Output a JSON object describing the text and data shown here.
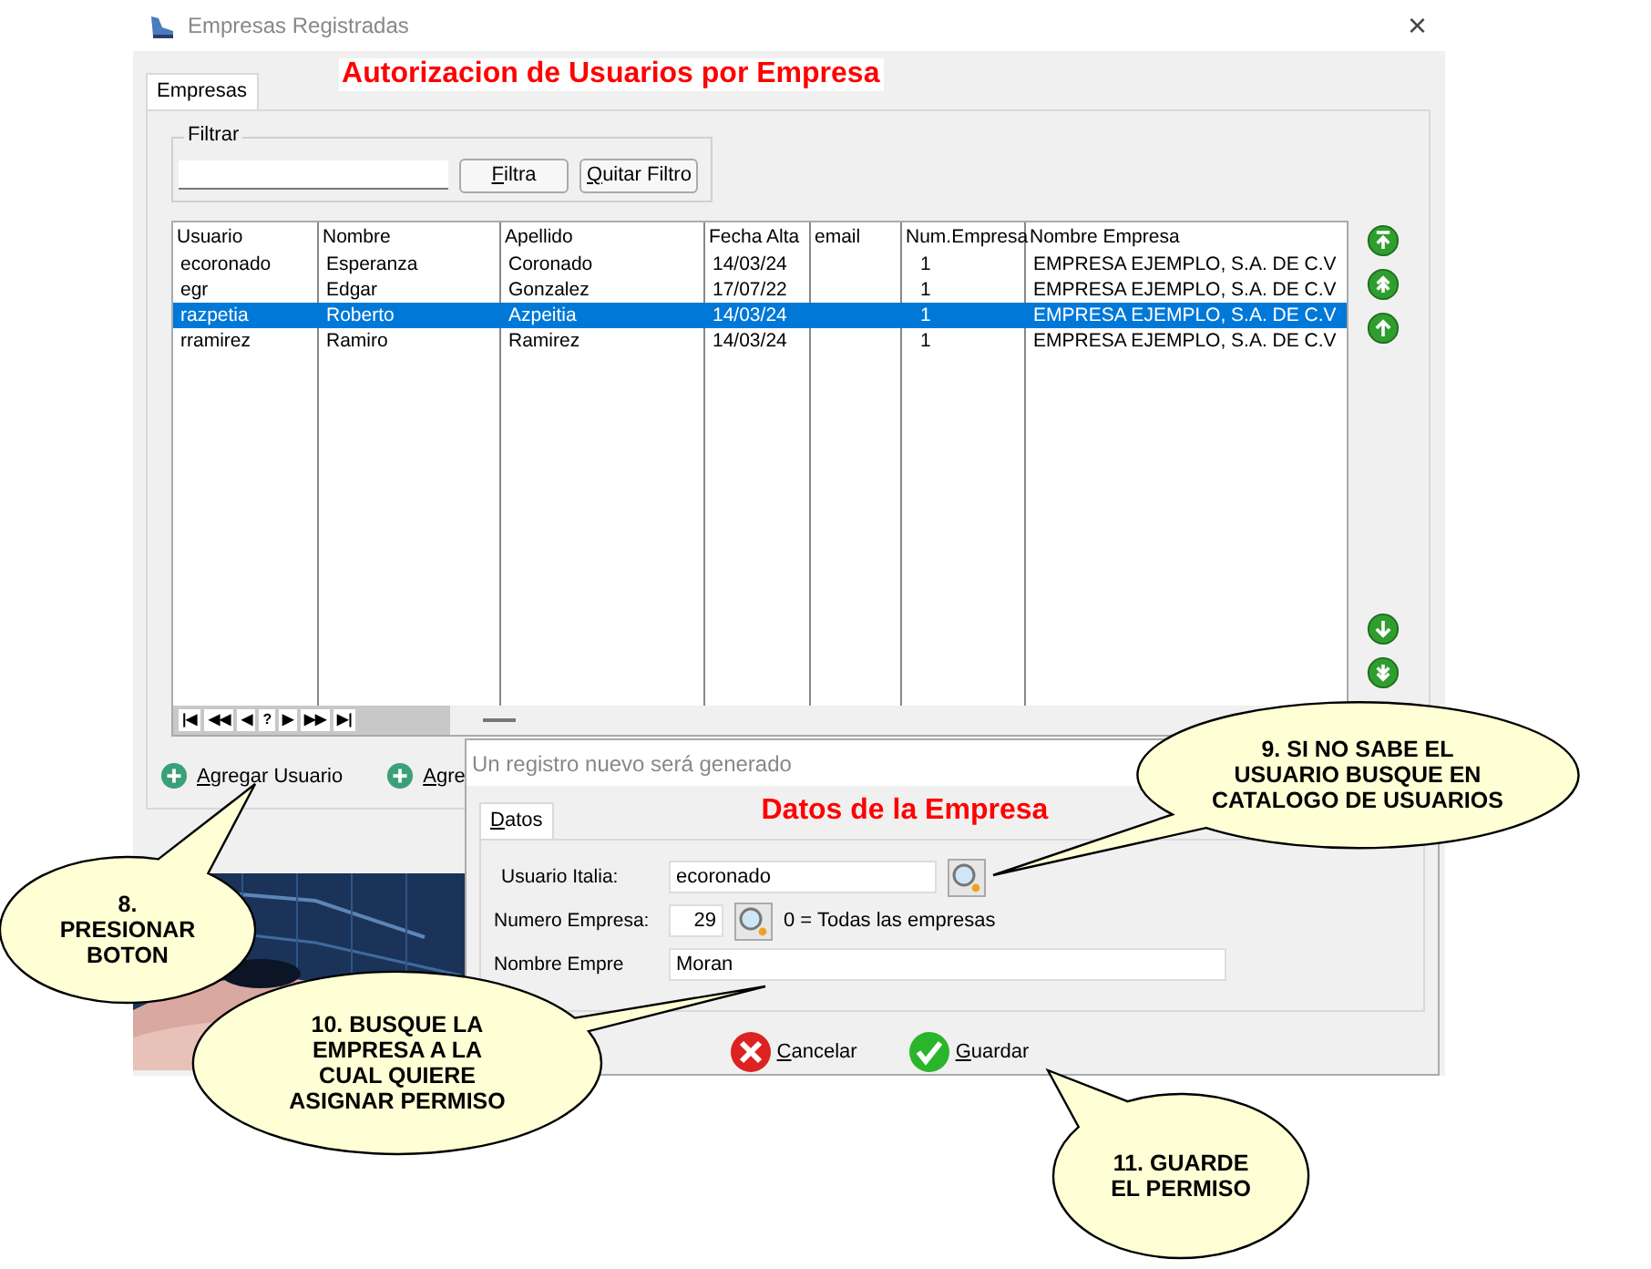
{
  "window": {
    "title": "Empresas Registradas",
    "close": "×"
  },
  "tabs": [
    {
      "label": "Empresas",
      "selected": true
    }
  ],
  "heading": "Autorizacion de Usuarios por Empresa",
  "filter": {
    "legend": "Filtrar",
    "buttons": [
      "Filtra",
      "Quitar Filtro"
    ]
  },
  "table": {
    "columns": [
      "Usuario",
      "Nombre",
      "Apellido",
      "Fecha Alta",
      "email",
      "Num.Empresa",
      "Nombre Empresa"
    ],
    "rows": [
      {
        "cells": [
          "ecoronado",
          "Esperanza",
          "Coronado",
          "14/03/24",
          "",
          "1",
          "EMPRESA EJEMPLO, S.A. DE C.V"
        ],
        "selected": false
      },
      {
        "cells": [
          "egr",
          "Edgar",
          "Gonzalez",
          "17/07/22",
          "",
          "1",
          "EMPRESA EJEMPLO, S.A. DE C.V"
        ],
        "selected": false
      },
      {
        "cells": [
          "razpetia",
          "Roberto",
          "Azpeitia",
          "14/03/24",
          "",
          "1",
          "EMPRESA EJEMPLO, S.A. DE C.V"
        ],
        "selected": true
      },
      {
        "cells": [
          "rramirez",
          "Ramiro",
          "Ramirez",
          "14/03/24",
          "",
          "1",
          "EMPRESA EJEMPLO, S.A. DE C.V"
        ],
        "selected": false
      }
    ],
    "navigator": [
      "|◀",
      "◀◀",
      "◀",
      "?",
      "▶",
      "▶▶",
      "▶|"
    ]
  },
  "side_buttons": [
    {
      "kind": "first"
    },
    {
      "kind": "pageup"
    },
    {
      "kind": "up"
    },
    {
      "kind": "down"
    },
    {
      "kind": "pagedown"
    }
  ],
  "actions": [
    "Agregar Usuario",
    "Agre"
  ],
  "picture": {
    "kind": "picture"
  },
  "dialog": {
    "title": "Un registro nuevo será generado",
    "tabs": [
      {
        "label": "Datos",
        "selected": true
      }
    ],
    "heading": "Datos de la Empresa",
    "fields": [
      {
        "label": "Usuario Italia:",
        "value": "ecoronado",
        "kind": "lookup"
      },
      {
        "label": "Numero Empresa:",
        "value": "29",
        "kind": "number",
        "hint": "0 = Todas las empresas"
      },
      {
        "label": "Nombre Empre",
        "value": "Moran",
        "kind": "text"
      }
    ],
    "buttons": [
      {
        "label": "Cancelar",
        "kind": "cancel"
      },
      {
        "label": "Guardar",
        "kind": "ok"
      }
    ]
  },
  "callouts": [
    {
      "lines": [
        "8.",
        "PRESIONAR",
        "BOTON"
      ]
    },
    {
      "lines": [
        "9. SI NO SABE EL",
        "USUARIO BUSQUE EN",
        "CATALOGO DE USUARIOS"
      ]
    },
    {
      "lines": [
        "10. BUSQUE LA",
        "EMPRESA A LA",
        "CUAL QUIERE",
        "ASIGNAR PERMISO"
      ]
    },
    {
      "lines": [
        "11. GUARDE",
        "EL PERMISO"
      ]
    }
  ]
}
